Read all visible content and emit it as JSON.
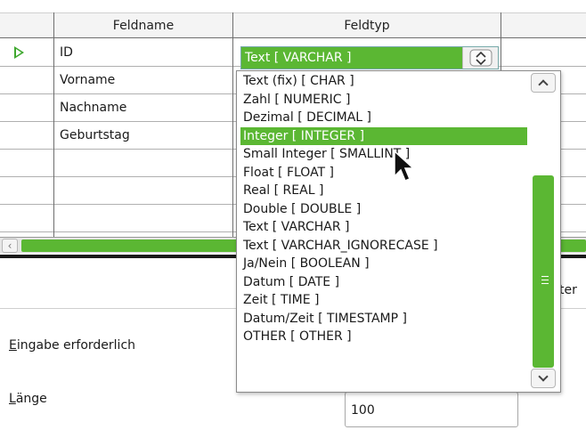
{
  "table": {
    "headers": [
      "Feldname",
      "Feldtyp"
    ],
    "rows": [
      {
        "name": "ID",
        "current": true
      },
      {
        "name": "Vorname",
        "current": false
      },
      {
        "name": "Nachname",
        "current": false
      },
      {
        "name": "Geburtstag",
        "current": false
      },
      {
        "name": "",
        "current": false
      },
      {
        "name": "",
        "current": false
      },
      {
        "name": "",
        "current": false
      }
    ]
  },
  "combo": {
    "value": "Text [ VARCHAR ]"
  },
  "dropdown": {
    "options": [
      "Text (fix) [ CHAR ]",
      "Zahl [ NUMERIC ]",
      "Dezimal [ DECIMAL ]",
      "Integer [ INTEGER ]",
      "Small Integer [ SMALLINT ]",
      "Float [ FLOAT ]",
      "Real [ REAL ]",
      "Double [ DOUBLE ]",
      "Text [ VARCHAR ]",
      "Text [ VARCHAR_IGNORECASE ]",
      "Ja/Nein [ BOOLEAN ]",
      "Datum [ DATE ]",
      "Zeit [ TIME ]",
      "Datum/Zeit [ TIMESTAMP ]",
      "OTHER [ OTHER ]"
    ],
    "highlighted_index": 3
  },
  "properties": {
    "required_label_first": "E",
    "required_label_rest": "ingabe erforderlich",
    "length_label_first": "L",
    "length_label_rest": "änge",
    "length_value": "100",
    "side_text": "ter"
  },
  "icons": {
    "row_marker": "current-row-arrow-icon",
    "scroll_left": "chevron-left-icon",
    "scroll_up": "chevron-up-icon",
    "scroll_down": "chevron-down-icon",
    "spin": "spin-updown-icon",
    "cursor": "mouse-pointer-icon"
  },
  "colors": {
    "accent": "#5bb733",
    "row_marker": "#3ea82e"
  }
}
